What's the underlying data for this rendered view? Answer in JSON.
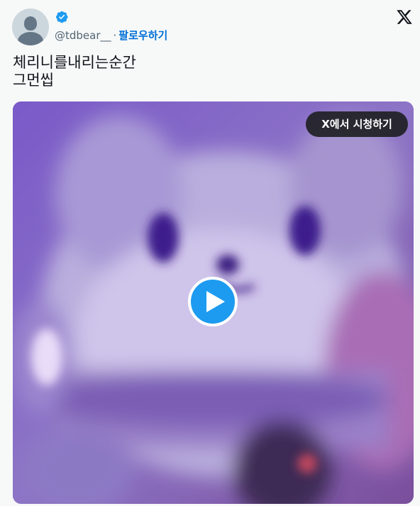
{
  "author": {
    "handle": "@tdbear__",
    "separator": "·",
    "follow_label": "팔로우하기",
    "verified": true
  },
  "tweet": {
    "lines": [
      "체리니를내리는순간",
      "그먼씹"
    ]
  },
  "media": {
    "watch_label": "X에서 시청하기",
    "type": "video"
  },
  "icons": {
    "verified": "verified-badge-icon",
    "logo": "x-logo-icon",
    "play": "play-icon",
    "avatar": "default-avatar-icon"
  },
  "colors": {
    "accent": "#1d9bf0",
    "follow": "#006fd6",
    "background": "#f7f9f9",
    "watch_bg": "#202124"
  }
}
